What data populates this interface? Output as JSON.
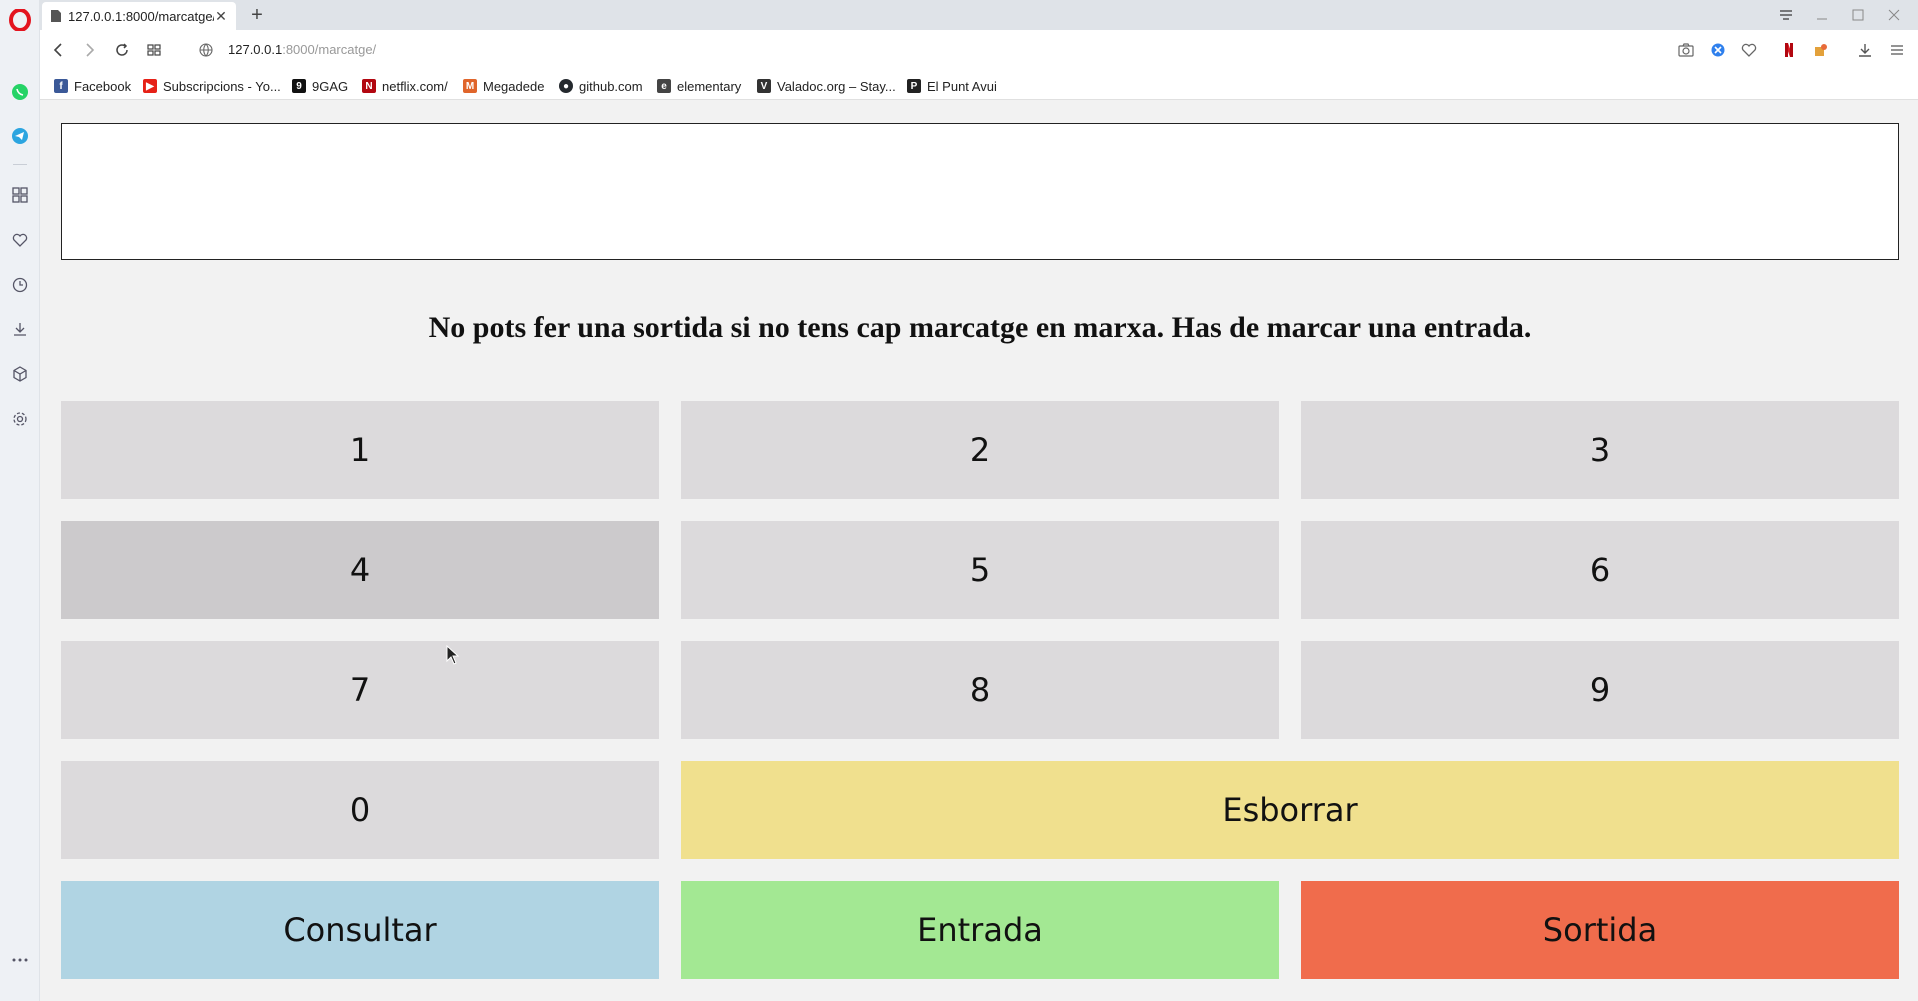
{
  "browser": {
    "tab": {
      "title": "127.0.0.1:8000/marcatge/"
    },
    "url": {
      "host": "127.0.0.1",
      "path": ":8000/marcatge/"
    },
    "bookmarks": [
      {
        "label": "Facebook",
        "icon": "facebook-icon",
        "color": "#3b5998"
      },
      {
        "label": "Subscripcions - Yo...",
        "icon": "youtube-icon",
        "color": "#e62117"
      },
      {
        "label": "9GAG",
        "icon": "9gag-icon",
        "color": "#111111"
      },
      {
        "label": "netflix.com/",
        "icon": "netflix-icon",
        "color": "#b20710"
      },
      {
        "label": "Megadede",
        "icon": "megadede-icon",
        "color": "#e0652b"
      },
      {
        "label": "github.com",
        "icon": "github-icon",
        "color": "#24292e"
      },
      {
        "label": "elementary",
        "icon": "elementary-icon",
        "color": "#444444"
      },
      {
        "label": "Valadoc.org – Stay...",
        "icon": "valadoc-icon",
        "color": "#333333"
      },
      {
        "label": "El Punt Avui",
        "icon": "elpuntavui-icon",
        "color": "#222222"
      }
    ]
  },
  "page": {
    "display_value": "",
    "message": "No pots fer una sortida si no tens cap marcatge en marxa. Has de marcar una entrada.",
    "keypad": [
      "1",
      "2",
      "3",
      "4",
      "5",
      "6",
      "7",
      "8",
      "9",
      "0"
    ],
    "esborrar_label": "Esborrar",
    "consultar_label": "Consultar",
    "entrada_label": "Entrada",
    "sortida_label": "Sortida",
    "colors": {
      "key": "#dcdadc",
      "esborrar": "#f0e08e",
      "consultar": "#b0d4e3",
      "entrada": "#a3e893",
      "sortida": "#f06c4c"
    }
  }
}
